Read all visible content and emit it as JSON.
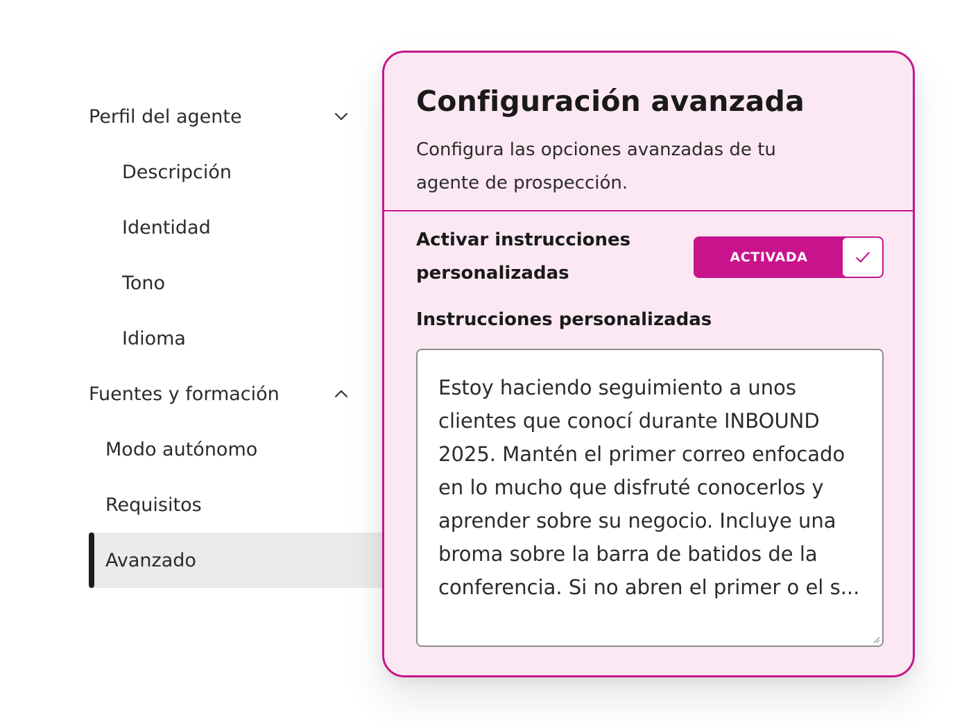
{
  "nav": {
    "items": [
      {
        "label": "Perfil del agente",
        "level": "section",
        "chevron": "down"
      },
      {
        "label": "Descripción",
        "level": "sub-deep"
      },
      {
        "label": "Identidad",
        "level": "sub-deep"
      },
      {
        "label": "Tono",
        "level": "sub-deep"
      },
      {
        "label": "Idioma",
        "level": "sub-deep"
      },
      {
        "label": "Fuentes y formación",
        "level": "section",
        "chevron": "up"
      },
      {
        "label": "Modo autónomo",
        "level": "sub"
      },
      {
        "label": "Requisitos",
        "level": "sub"
      },
      {
        "label": "Avanzado",
        "level": "sub",
        "active": true
      }
    ]
  },
  "panel": {
    "title": "Configuración avanzada",
    "subtitle": "Configura las opciones avanzadas de tu agente de prospección.",
    "toggle_label": "Activar instrucciones personalizadas",
    "toggle_state_text": "ACTIVADA",
    "toggle_on": true,
    "field_label": "Instrucciones personalizadas",
    "instructions_value": "Estoy haciendo seguimiento a unos clientes que conocí durante INBOUND 2025. Mantén el primer correo enfocado en lo mucho que disfruté conocerlos y aprender sobre su negocio. Incluye una broma sobre la barra de batidos de la conferencia. Si no abren el primer o el s..."
  },
  "icons": {
    "section_open": "chevron-down-icon",
    "section_collapse": "chevron-up-icon",
    "toggle_check": "checkmark-icon",
    "resize": "resize-handle-icon"
  },
  "colors": {
    "accent": "#c5168f",
    "toggle_fill": "#c9138c",
    "card_background": "#fce8f2",
    "active_nav_background": "#ebebeb",
    "active_nav_indicator": "#1c1c1c"
  }
}
